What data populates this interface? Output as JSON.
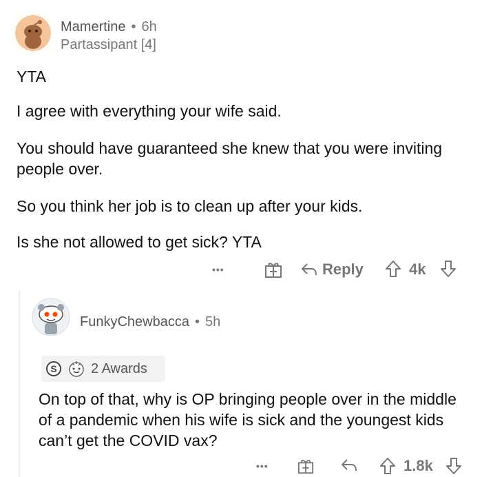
{
  "comment1": {
    "username": "Mamertine",
    "separator": "•",
    "time": "6h",
    "flair": "Partassipant [4]",
    "paragraphs": [
      "YTA",
      "I agree with everything your wife said.",
      "You should have guaranteed she knew that you were inviting people over.",
      "So you think her job is to clean up after your kids.",
      "Is she not allowed to get sick? YTA"
    ],
    "actions": {
      "more": "•••",
      "reply": "Reply",
      "score": "4k"
    }
  },
  "comment2": {
    "username": "FunkyChewbacca",
    "separator": "•",
    "time": "5h",
    "awards": "2 Awards",
    "text": "On top of that, why is OP bringing people over in the middle of a pandemic when his wife is sick and the youngest kids can’t get the COVID vax?",
    "actions": {
      "more": "•••",
      "score": "1.8k"
    }
  },
  "icons": [
    "gift-icon",
    "reply-icon",
    "upvote-icon",
    "downvote-icon",
    "more-icon",
    "silver-award-icon",
    "wholesome-award-icon"
  ]
}
